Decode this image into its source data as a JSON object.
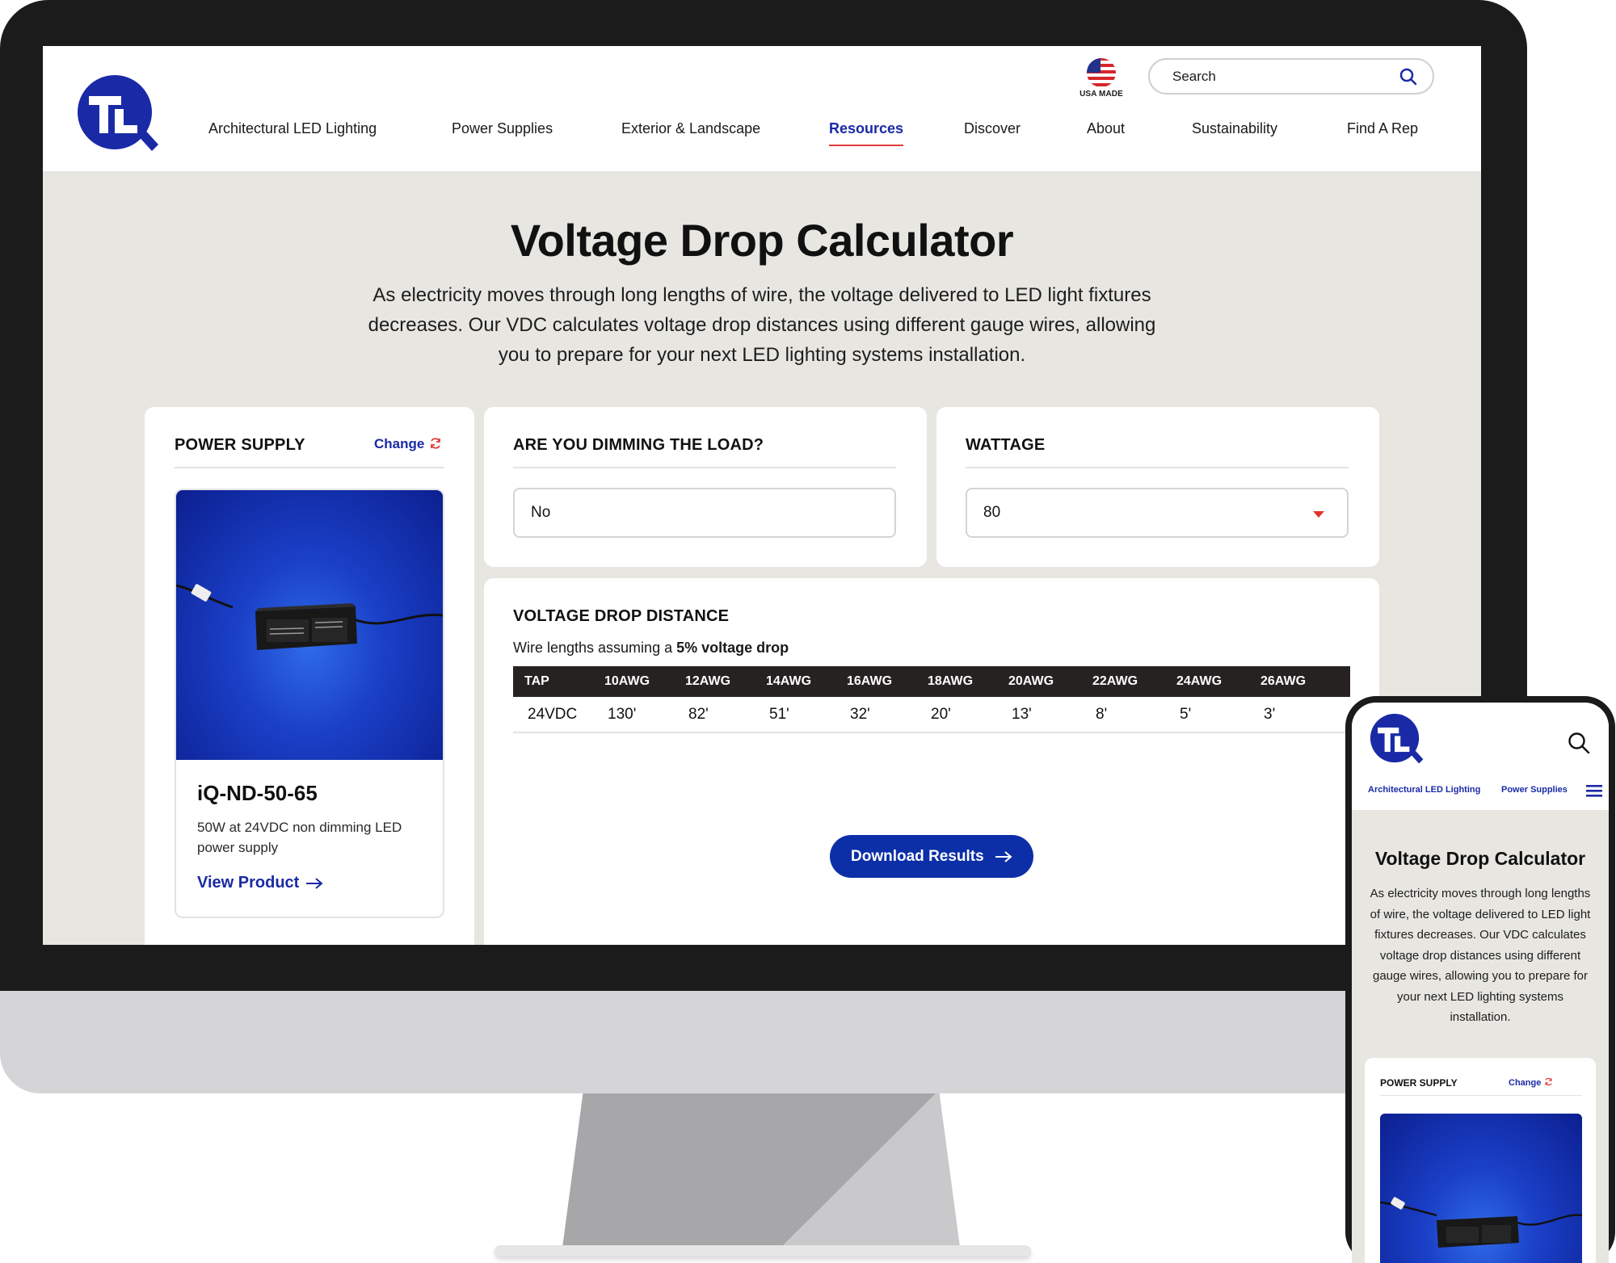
{
  "desktop": {
    "header": {
      "usa_label": "USA MADE",
      "search_placeholder": "Search"
    },
    "nav": [
      {
        "label": "Architectural LED Lighting",
        "active": false
      },
      {
        "label": "Power Supplies",
        "active": false
      },
      {
        "label": "Exterior & Landscape",
        "active": false
      },
      {
        "label": "Resources",
        "active": true
      },
      {
        "label": "Discover",
        "active": false
      },
      {
        "label": "About",
        "active": false
      },
      {
        "label": "Sustainability",
        "active": false
      },
      {
        "label": "Find A Rep",
        "active": false
      }
    ],
    "page": {
      "title": "Voltage Drop Calculator",
      "intro": "As electricity moves through long lengths of wire, the voltage delivered to LED light fixtures decreases. Our VDC calculates voltage drop distances using different gauge wires, allowing you to prepare for your next LED lighting systems installation."
    },
    "power_supply": {
      "title": "POWER SUPPLY",
      "change_label": "Change",
      "product_name": "iQ-ND-50-65",
      "product_desc": "50W at 24VDC non dimming LED power supply",
      "view_label": "View Product"
    },
    "dimming": {
      "title": "ARE YOU DIMMING THE LOAD?",
      "value": "No"
    },
    "wattage": {
      "title": "WATTAGE",
      "value": "80"
    },
    "voltage_drop": {
      "title": "VOLTAGE DROP DISTANCE",
      "subtitle_prefix": "Wire lengths assuming a",
      "subtitle_bold": "5% voltage drop",
      "columns": [
        "TAP",
        "10AWG",
        "12AWG",
        "14AWG",
        "16AWG",
        "18AWG",
        "20AWG",
        "22AWG",
        "24AWG",
        "26AWG"
      ],
      "rows": [
        [
          "24VDC",
          "130'",
          "82'",
          "51'",
          "32'",
          "20'",
          "13'",
          "8'",
          "5'",
          "3'"
        ]
      ],
      "download_label": "Download Results"
    }
  },
  "mobile": {
    "nav": [
      "Architectural LED Lighting",
      "Power Supplies"
    ],
    "title": "Voltage Drop Calculator",
    "intro": "As electricity moves through long lengths of wire, the voltage delivered to LED light fixtures decreases. Our VDC calculates voltage drop distances using different gauge wires, allowing you to prepare for your next LED lighting systems installation.",
    "power_supply_title": "POWER SUPPLY",
    "change_label": "Change"
  },
  "colors": {
    "brand_blue": "#1a2aa6",
    "button_blue": "#0c2fa8",
    "accent_red": "#e23b3b",
    "page_bg": "#e7e6e1",
    "table_header": "#262222"
  }
}
